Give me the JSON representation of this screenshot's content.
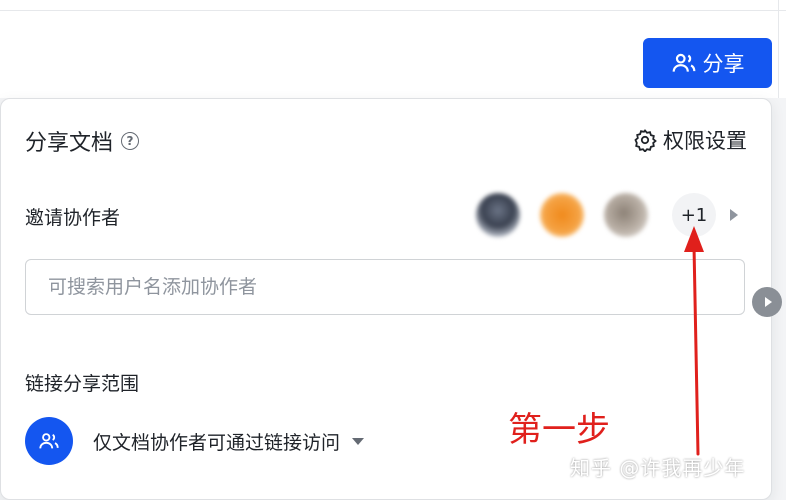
{
  "header": {
    "share_button_label": "分享",
    "share_button_icon": "users-icon",
    "accent_color": "#1456f0"
  },
  "share_panel": {
    "title": "分享文档",
    "help_icon": "question-circle-icon",
    "help_glyph": "?",
    "permission_settings_label": "权限设置",
    "permission_settings_icon": "gear-icon",
    "invite_label": "邀请协作者",
    "collaborator_avatars": [
      "avatar-1",
      "avatar-2",
      "avatar-3"
    ],
    "more_collaborators": "+1",
    "search_placeholder": "可搜索用户名添加协作者",
    "link_scope_label": "链接分享范围",
    "link_scope_value": "仅文档协作者可通过链接访问",
    "link_scope_icon": "users-icon"
  },
  "annotation": {
    "step_text": "第一步",
    "color": "#e0201c"
  },
  "watermark": "知乎 @许我再少年"
}
